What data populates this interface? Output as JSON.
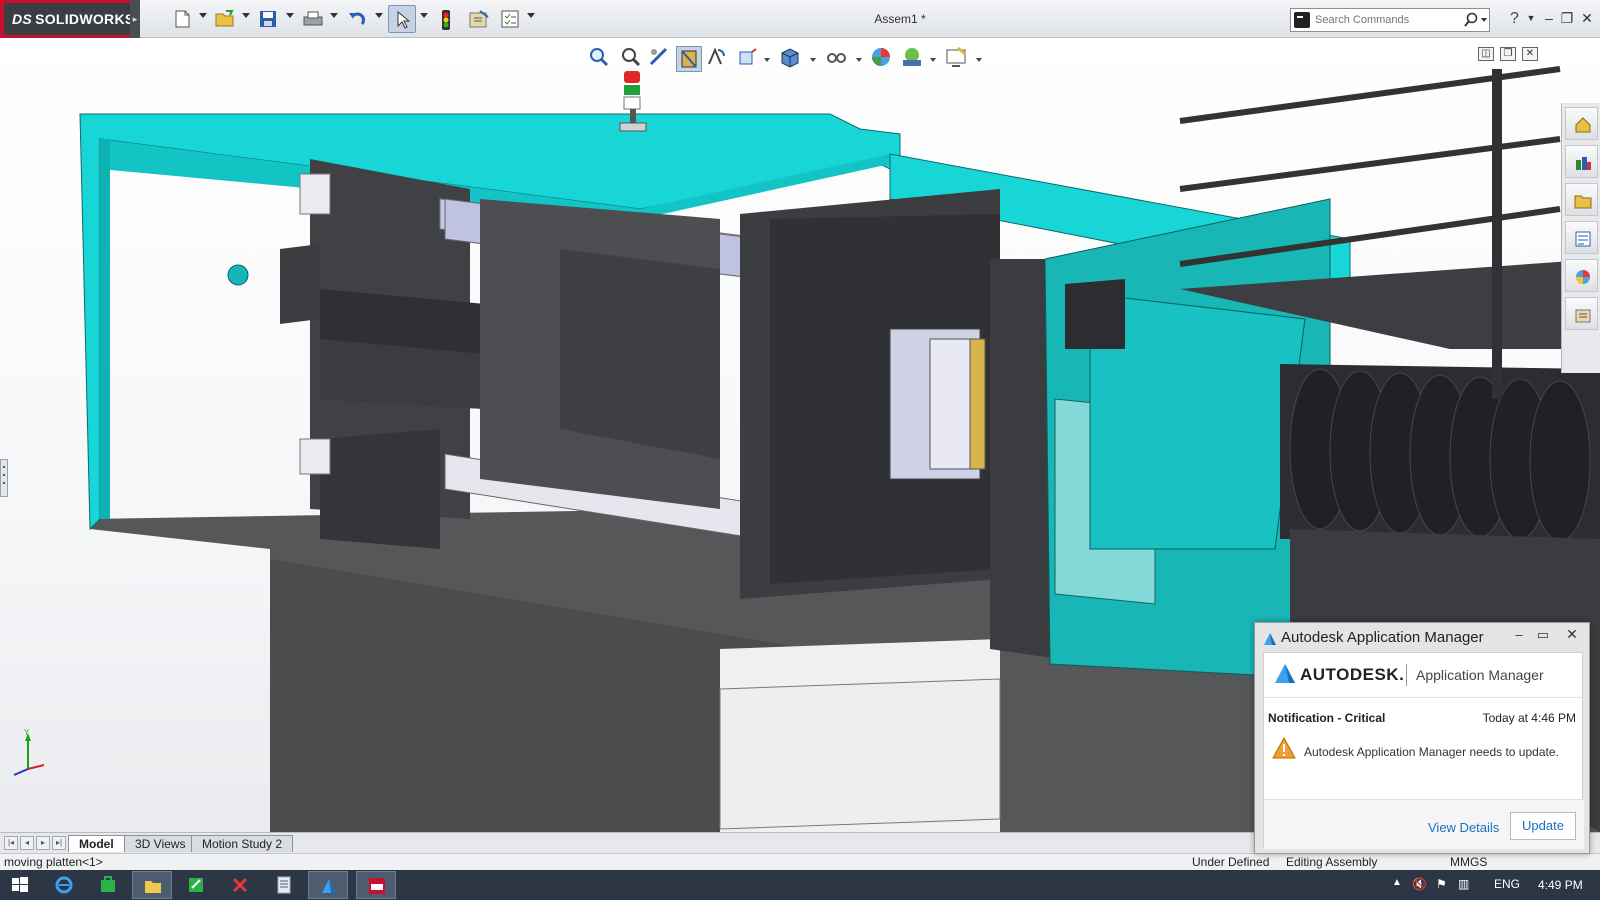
{
  "app": {
    "logo_text": "SOLIDWORKS",
    "logo_prefix": "DS",
    "document_title": "Assem1 *"
  },
  "toolbar": {
    "items": [
      "new-file",
      "open-file",
      "save",
      "print",
      "undo",
      "select",
      "rebuild",
      "file-properties",
      "options"
    ]
  },
  "search": {
    "placeholder": "Search Commands"
  },
  "tabs": [
    {
      "label": "Model",
      "active": true
    },
    {
      "label": "3D Views",
      "active": false
    },
    {
      "label": "Motion Study 2",
      "active": false
    }
  ],
  "statusbar": {
    "left": "moving platten<1>",
    "state": "Under Defined",
    "mode": "Editing Assembly",
    "units": "MMGS"
  },
  "taskbar": {
    "tray_lang": "ENG",
    "clock": "4:49 PM"
  },
  "notification": {
    "window_title": "Autodesk Application Manager",
    "brand": "AUTODESK.",
    "product": "Application Manager",
    "type": "Notification - Critical",
    "time": "Today at 4:46 PM",
    "message": "Autodesk Application Manager needs to update.",
    "link": "View Details",
    "button": "Update"
  },
  "colors": {
    "machine_frame": "#19d6d6",
    "machine_dark": "#3f4144",
    "sw_red": "#c8102e",
    "autodesk_link": "#1a6fc2"
  }
}
